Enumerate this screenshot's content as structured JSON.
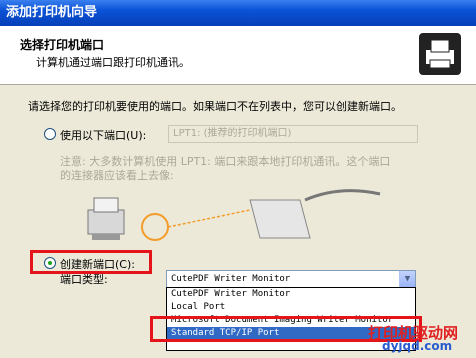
{
  "window": {
    "title": "添加打印机向导"
  },
  "header": {
    "title": "选择打印机端口",
    "subtitle": "计算机通过端口跟打印机通讯。",
    "icon": "printer-icon"
  },
  "instruction": "请选择您的打印机要使用的端口。如果端口不在列表中，您可以创建新端口。",
  "use_port": {
    "label": "使用以下端口(U):",
    "value": "LPT1: (推荐的打印机端口)",
    "selected": false
  },
  "note": {
    "line1": "注意: 大多数计算机使用 LPT1: 端口来跟本地打印机通讯。这个端口",
    "line2": "的连接器应该看上去像:"
  },
  "create_port": {
    "label": "创建新端口(C):",
    "selected": true,
    "type_label": "端口类型:",
    "type_value": "CutePDF Writer Monitor"
  },
  "port_options": [
    "CutePDF Writer Monitor",
    "Local Port",
    "Microsoft Document Imaging Writer Monitor",
    "Standard TCP/IP Port"
  ],
  "selected_option_index": 3,
  "watermark": {
    "text1": "打印机驱动网",
    "text2": "dyjqd.com"
  },
  "colors": {
    "highlight": "#e5141b",
    "selection": "#316ac5",
    "titlebar": "#0a52d6"
  }
}
